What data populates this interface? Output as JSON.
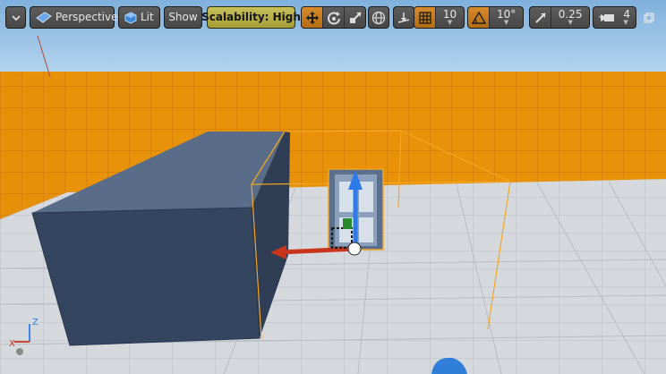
{
  "toolbar": {
    "view_mode_label": "Perspective",
    "lit_label": "Lit",
    "show_label": "Show",
    "scalability_label": "Scalability: High",
    "grid_snap_value": "10",
    "rotation_snap_value": "10°",
    "scale_snap_value": "0.25",
    "camera_speed_value": "4"
  },
  "colors": {
    "wall": "#e8920a",
    "floor": "#cfd3d8",
    "sky": "#9ec6e8",
    "box": "#3b4d66",
    "selection": "#f5a623",
    "accent_active": "#c97a1f",
    "scalability": "#b5ad45",
    "gizmo_x": "#c8341c",
    "gizmo_z": "#2d7bea"
  },
  "icons": [
    "menu-chevron-down-icon",
    "perspective-icon",
    "lit-cube-icon",
    "translate-icon",
    "rotate-icon",
    "scale-icon",
    "world-coordinate-icon",
    "surface-snap-icon",
    "grid-snap-icon",
    "rotation-snap-icon",
    "scale-snap-icon",
    "camera-speed-icon",
    "maximize-icon"
  ]
}
